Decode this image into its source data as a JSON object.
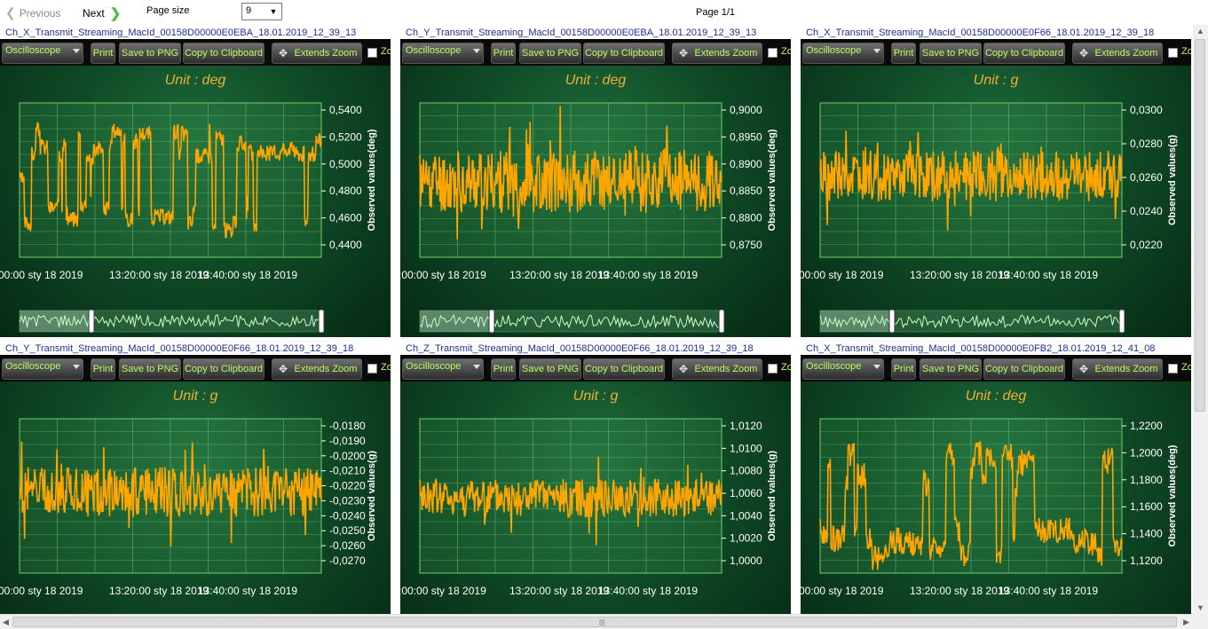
{
  "toolbar": {
    "previous_label": "Previous",
    "next_label": "Next",
    "page_size_label": "Page size",
    "page_size_value": "9",
    "page_info": "Page 1/1"
  },
  "panel_toolbar": {
    "mode_label": "Oscilloscope",
    "print_label": "Print",
    "save_png_label": "Save to PNG",
    "copy_clipboard_label": "Copy to Clipboard",
    "extends_zoom_label": "Extends Zoom",
    "zoom_partial_label": "Zo"
  },
  "colors": {
    "signal": "#ffa500",
    "grid": "#6fcf6f",
    "unit_text": "#f0b030",
    "button_text": "#b8ff60",
    "title_text": "#1d2f9a"
  },
  "panels": [
    {
      "title": "Ch_X_Transmit_Streaming_MacId_00158D00000E0EBA_18.01.2019_12_39_13",
      "unit": "Unit : deg",
      "y_axis_title": "Observed values(deg)",
      "y_ticks": [
        "0,5400",
        "0,5200",
        "0,5000",
        "0,4800",
        "0,4600",
        "0,4400"
      ],
      "x_ticks": [
        "00:00 sty 18 2019",
        "13:20:00 sty 18 2019",
        "13:40:00 sty 18 2019"
      ],
      "has_navigator": true,
      "chart_data": {
        "type": "line",
        "ylim": [
          0.434,
          0.548
        ],
        "mean": 0.491,
        "amplitude": 0.038,
        "noise": 0.006,
        "style": "square-bursts",
        "seed": 3
      }
    },
    {
      "title": "Ch_Y_Transmit_Streaming_MacId_00158D00000E0EBA_18.01.2019_12_39_13",
      "unit": "Unit : deg",
      "y_axis_title": "Observed values(deg)",
      "y_ticks": [
        "0,9000",
        "0,8950",
        "0,8900",
        "0,8850",
        "0,8800",
        "0,8750"
      ],
      "x_ticks": [
        ":00:00 sty 18 2019",
        "13:20:00 sty 18 2019",
        "13:40:00 sty 18 2019"
      ],
      "has_navigator": true,
      "chart_data": {
        "type": "line",
        "ylim": [
          0.8725,
          0.9015
        ],
        "mean": 0.8868,
        "amplitude": 0.006,
        "noise": 0.004,
        "style": "dense-noise",
        "seed": 11
      }
    },
    {
      "title": "Ch_X_Transmit_Streaming_MacId_00158D00000E0F66_18.01.2019_12_39_18",
      "unit": "Unit : g",
      "y_axis_title": "Observed values(g)",
      "y_ticks": [
        "0,0300",
        "0,0280",
        "0,0260",
        "0,0240",
        "0,0220"
      ],
      "x_ticks": [
        "00:00 sty 18 2019",
        "13:20:00 sty 18 2019",
        "13:40:00 sty 18 2019"
      ],
      "has_navigator": true,
      "chart_data": {
        "type": "line",
        "ylim": [
          0.0205,
          0.0313
        ],
        "mean": 0.0262,
        "amplitude": 0.0018,
        "noise": 0.0012,
        "style": "dense-noise",
        "seed": 19
      }
    },
    {
      "title": "Ch_Y_Transmit_Streaming_MacId_00158D00000E0F66_18.01.2019_12_39_18",
      "unit": "Unit : g",
      "y_axis_title": "Observed values(g)",
      "y_ticks": [
        "-0,0180",
        "-0,0190",
        "-0,0200",
        "-0,0210",
        "-0,0220",
        "-0,0230",
        "-0,0240",
        "-0,0250",
        "-0,0260",
        "-0,0270"
      ],
      "x_ticks": [
        "00:00 sty 18 2019",
        "13:20:00 sty 18 2019",
        "13:40:00 sty 18 2019"
      ],
      "has_navigator": false,
      "chart_data": {
        "type": "line",
        "ylim": [
          -0.0275,
          -0.0176
        ],
        "mean": -0.0223,
        "amplitude": 0.0016,
        "noise": 0.0012,
        "style": "dense-noise",
        "seed": 27
      }
    },
    {
      "title": "Ch_Z_Transmit_Streaming_MacId_00158D00000E0F66_18.01.2019_12_39_18",
      "unit": "Unit : g",
      "y_axis_title": "Observed values(g)",
      "y_ticks": [
        "1,0120",
        "1,0100",
        "1,0080",
        "1,0060",
        "1,0040",
        "1,0020",
        "1,0000"
      ],
      "x_ticks": [
        ":00:00 sty 18 2019",
        "13:20:00 sty 18 2019",
        "13:40:00 sty 18 2019"
      ],
      "has_navigator": false,
      "chart_data": {
        "type": "line",
        "ylim": [
          0.9988,
          1.0132
        ],
        "mean": 1.0058,
        "amplitude": 0.0018,
        "noise": 0.0014,
        "style": "dense-noise",
        "seed": 41
      }
    },
    {
      "title": "Ch_X_Transmit_Streaming_MacId_00158D00000E0FB2_18.01.2019_12_41_08",
      "unit": "Unit : deg",
      "y_axis_title": "Observed values(deg)",
      "y_ticks": [
        "1,2200",
        "1,2000",
        "1,1800",
        "1,1600",
        "1,1400",
        "1,1200"
      ],
      "x_ticks": [
        "00:00 sty 18 2019",
        "13:20:00 sty 18 2019",
        "13:40:00 sty 18 2019"
      ],
      "has_navigator": false,
      "chart_data": {
        "type": "line",
        "ylim": [
          1.112,
          1.226
        ],
        "mean": 1.162,
        "amplitude": 0.04,
        "noise": 0.01,
        "style": "square-bursts",
        "seed": 53
      }
    }
  ]
}
